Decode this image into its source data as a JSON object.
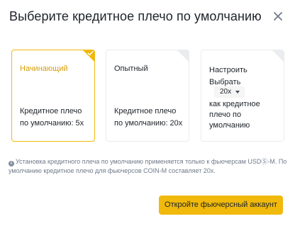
{
  "dialog": {
    "title": "Выберите кредитное плечо по умолчанию",
    "close_icon": "close-icon"
  },
  "cards": [
    {
      "name": "Начинающий",
      "line1": "Кредитное плечо",
      "line2": "по умолчанию: 5x",
      "selected": true
    },
    {
      "name": "Опытный",
      "line1": "Кредитное плечо",
      "line2": "по умолчанию: 20x",
      "selected": false
    },
    {
      "name": "Настроить",
      "select_label": "Выбрать",
      "select_value": "20x",
      "line1": "как кредитное",
      "line2": "плечо по",
      "line3": "умолчанию",
      "selected": false
    }
  ],
  "note": {
    "icon": "info-icon",
    "text": "Установка кредитного плеча по умолчанию применяется только к фьючерсам USDⓈ-M. По умолчанию кредитное плечо для фьючерсов COIN-M составляет 20x."
  },
  "action": {
    "label": "Откройте фьючерсный аккаунт"
  },
  "colors": {
    "accent": "#f0b90b",
    "selected_text": "#d89e06",
    "border": "#eaecef",
    "muted_text": "#707a8a"
  }
}
